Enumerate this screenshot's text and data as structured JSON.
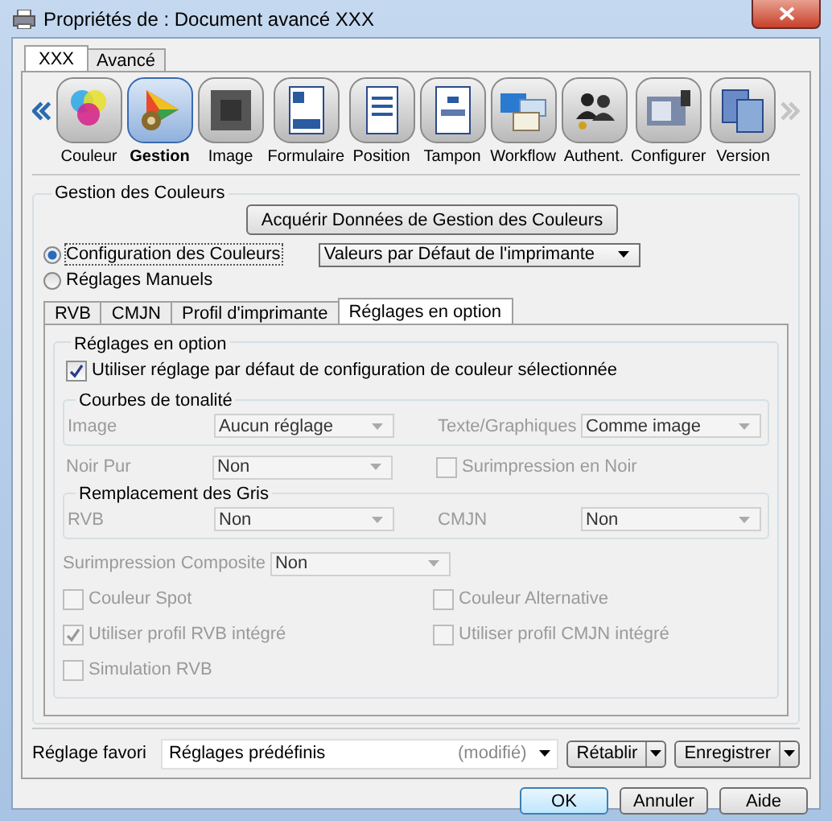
{
  "window": {
    "title": "Propriétés de : Document avancé XXX"
  },
  "tabs": [
    {
      "label": "XXX",
      "selected": true
    },
    {
      "label": "Avancé",
      "selected": false
    }
  ],
  "toolbar": {
    "items": [
      {
        "label": "Couleur",
        "selected": false
      },
      {
        "label": "Gestion",
        "selected": true
      },
      {
        "label": "Image",
        "selected": false
      },
      {
        "label": "Formulaire",
        "selected": false
      },
      {
        "label": "Position",
        "selected": false
      },
      {
        "label": "Tampon",
        "selected": false
      },
      {
        "label": "Workflow",
        "selected": false
      },
      {
        "label": "Authent.",
        "selected": false
      },
      {
        "label": "Configurer",
        "selected": false
      },
      {
        "label": "Version",
        "selected": false
      }
    ]
  },
  "color_management": {
    "title": "Gestion des Couleurs",
    "acquire_button": "Acquérir Données de Gestion des Couleurs",
    "modes": [
      {
        "label": "Configuration des Couleurs",
        "selected": true,
        "dropdown": "Valeurs par Défaut de l'imprimante"
      },
      {
        "label": "Réglages Manuels",
        "selected": false
      }
    ],
    "tabs": [
      {
        "label": "RVB",
        "selected": false
      },
      {
        "label": "CMJN",
        "selected": false
      },
      {
        "label": "Profil d'imprimante",
        "selected": false
      },
      {
        "label": "Réglages en option",
        "selected": true
      }
    ],
    "options": {
      "title": "Réglages en option",
      "use_default": {
        "label": "Utiliser réglage par défaut de configuration de couleur sélectionnée",
        "checked": true
      },
      "disabled": true,
      "tone_curves": {
        "title": "Courbes de tonalité",
        "fields": [
          {
            "label": "Image",
            "value": "Aucun réglage"
          },
          {
            "label": "Texte/Graphiques",
            "value": "Comme image"
          }
        ]
      },
      "pure_black": {
        "label": "Noir Pur",
        "value": "Non"
      },
      "black_overprint": {
        "label": "Surimpression en Noir",
        "checked": false
      },
      "gray_replacement": {
        "title": "Remplacement des Gris",
        "fields": [
          {
            "label": "RVB",
            "value": "Non"
          },
          {
            "label": "CMJN",
            "value": "Non"
          }
        ]
      },
      "composite_overprint": {
        "label": "Surimpression Composite",
        "value": "Non"
      },
      "checkboxes": [
        {
          "label": "Couleur Spot",
          "checked": false
        },
        {
          "label": "Couleur Alternative",
          "checked": false
        },
        {
          "label": "Utiliser profil RVB intégré",
          "checked": true
        },
        {
          "label": "Utiliser profil CMJN intégré",
          "checked": false
        },
        {
          "label": "Simulation RVB",
          "checked": false
        }
      ]
    }
  },
  "favorite": {
    "label": "Réglage favori",
    "value": "Réglages prédéfinis",
    "note": "(modifié)",
    "buttons": [
      "Rétablir",
      "Enregistrer"
    ]
  },
  "buttons": [
    {
      "label": "OK",
      "default": true
    },
    {
      "label": "Annuler",
      "default": false
    },
    {
      "label": "Aide",
      "default": false
    }
  ]
}
